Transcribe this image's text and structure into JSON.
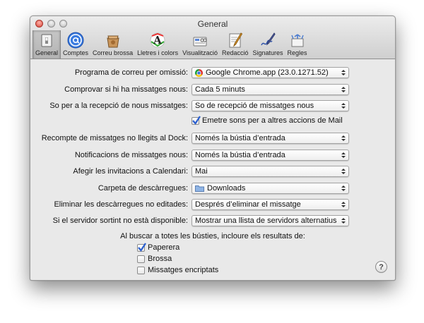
{
  "window": {
    "title": "General"
  },
  "toolbar": {
    "tabs": [
      {
        "label": "General",
        "icon": "switch-icon",
        "active": true
      },
      {
        "label": "Comptes",
        "icon": "at-sign-icon"
      },
      {
        "label": "Correu brossa",
        "icon": "junk-mail-icon"
      },
      {
        "label": "Lletres i colors",
        "icon": "font-colors-icon"
      },
      {
        "label": "Visualització",
        "icon": "viewing-icon"
      },
      {
        "label": "Redacció",
        "icon": "composing-icon"
      },
      {
        "label": "Signatures",
        "icon": "signature-icon"
      },
      {
        "label": "Regles",
        "icon": "rules-icon"
      }
    ]
  },
  "settings": {
    "default_mail": {
      "label": "Programa de correu per omissió:",
      "value": "Google Chrome.app (23.0.1271.52)",
      "icon": "chrome-icon"
    },
    "check_messages": {
      "label": "Comprovar si hi ha missatges nous:",
      "value": "Cada 5 minuts"
    },
    "new_mail_sound": {
      "label": "So per a la recepció de nous missatges:",
      "value": "So de recepció de missatges nous"
    },
    "play_sounds": {
      "label": "Emetre sons per a altres accions de Mail",
      "checked": true
    },
    "dock_unread": {
      "label": "Recompte de missatges no llegits al Dock:",
      "value": "Només la bústia d’entrada"
    },
    "notifications": {
      "label": "Notificacions de missatges nous:",
      "value": "Només la bústia d’entrada"
    },
    "calendar": {
      "label": "Afegir les invitacions a Calendari:",
      "value": "Mai"
    },
    "downloads": {
      "label": "Carpeta de descàrregues:",
      "value": "Downloads",
      "icon": "folder-icon"
    },
    "remove_downloads": {
      "label": "Eliminar les descàrregues no editades:",
      "value": "Després d’eliminar el missatge"
    },
    "outgoing_server": {
      "label": "Si el servidor sortint no està disponible:",
      "value": "Mostrar una llista de servidors alternatius"
    }
  },
  "search": {
    "label": "Al buscar a totes les bústies, incloure els resultats de:",
    "options": [
      {
        "label": "Paperera",
        "checked": true
      },
      {
        "label": "Brossa",
        "checked": false
      },
      {
        "label": "Missatges encriptats",
        "checked": false
      }
    ]
  },
  "help": {
    "label": "?"
  },
  "colors": {
    "accent": "#2a5fd0",
    "window_bg": "#e9e9e9"
  }
}
